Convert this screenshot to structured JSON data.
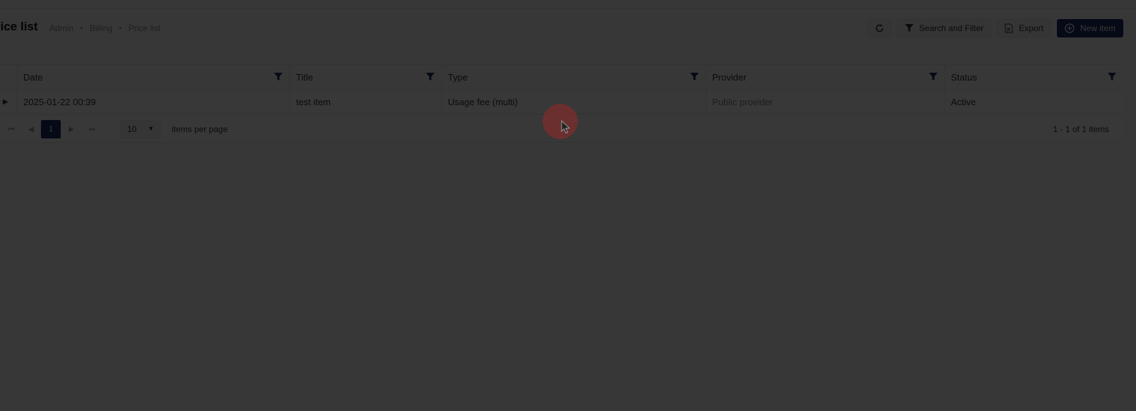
{
  "header": {
    "title": "rice list",
    "breadcrumb": [
      "Admin",
      "Billing",
      "Price list"
    ]
  },
  "toolbar": {
    "refresh_icon": "refresh-icon",
    "search_filter_label": "Search and Filter",
    "export_label": "Export",
    "new_item_label": "New item"
  },
  "grid": {
    "columns": [
      "Date",
      "Title",
      "Type",
      "Provider",
      "Status"
    ],
    "rows": [
      {
        "date": "2025-01-22 00:39",
        "title": "test item",
        "type": "Usage fee (multi)",
        "provider": "Public provider",
        "status": "Active"
      }
    ]
  },
  "pager": {
    "current_page": "1",
    "page_size": "10",
    "items_per_page_label": "items per page",
    "info": "1 - 1 of 1 items"
  },
  "colors": {
    "primary": "#1f2c63",
    "overlay": "rgba(0,0,0,0.78)",
    "click_indicator": "#962828"
  }
}
